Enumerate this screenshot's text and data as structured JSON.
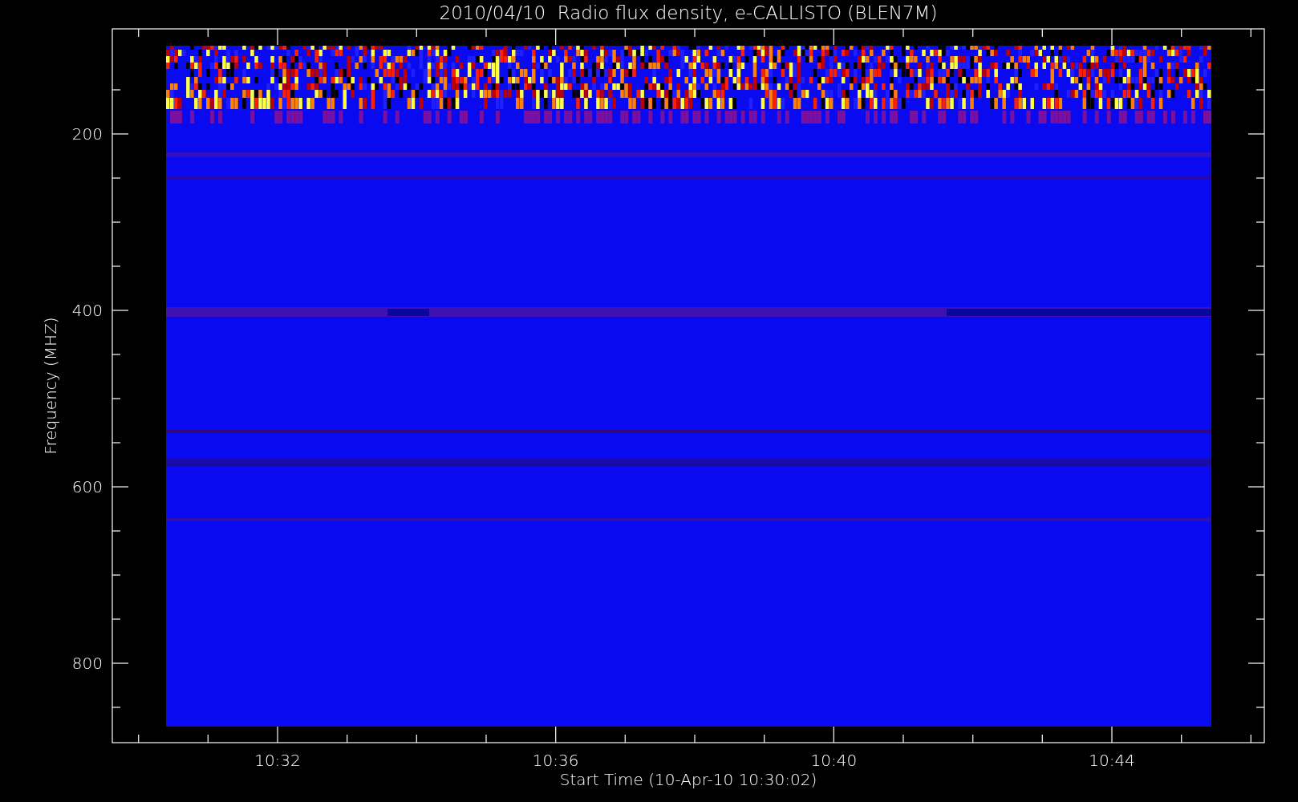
{
  "title": "2010/04/10  Radio flux density, e-CALLISTO (BLEN7M)",
  "y_axis": {
    "label": "Frequency (MHZ)",
    "ticks": [
      "200",
      "400",
      "600",
      "800"
    ]
  },
  "x_axis": {
    "label": "Start Time (10-Apr-10 10:30:02)",
    "ticks": [
      "10:32",
      "10:36",
      "10:40",
      "10:44"
    ]
  }
}
